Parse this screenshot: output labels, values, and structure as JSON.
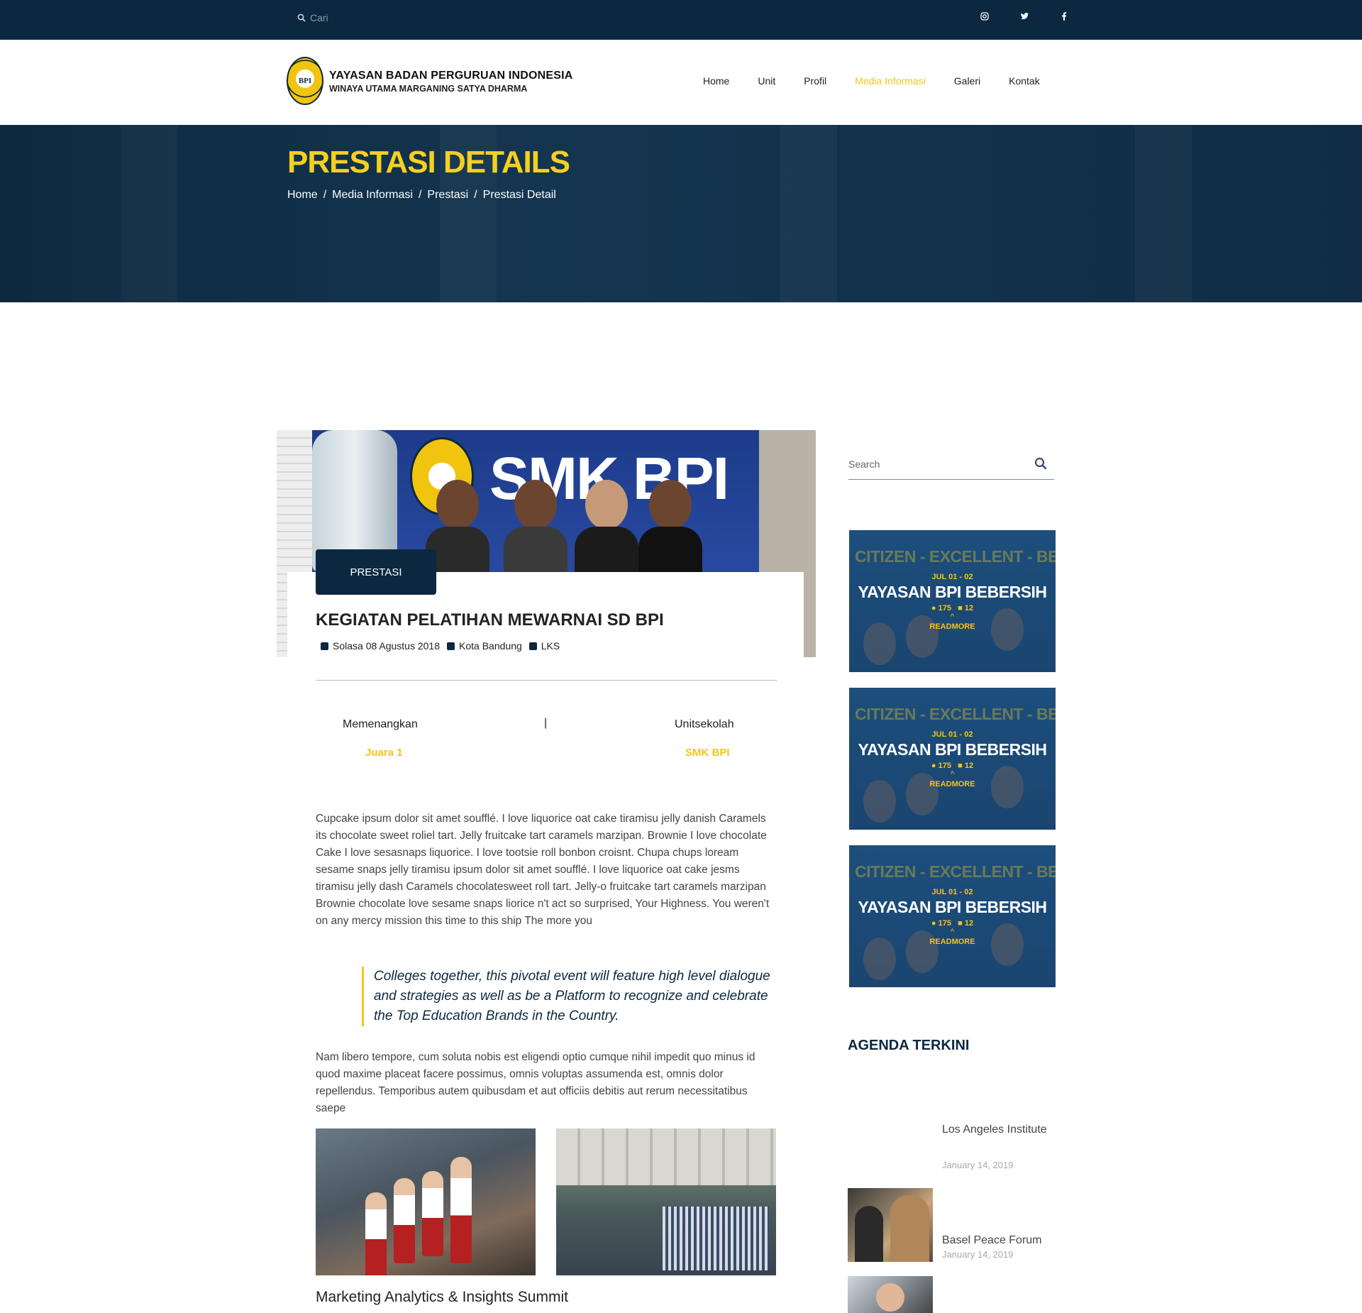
{
  "topbar": {
    "search_placeholder": "Cari",
    "socials": [
      "instagram-icon",
      "twitter-icon",
      "facebook-icon"
    ]
  },
  "header": {
    "logo_badge": "BPI",
    "logo_title": "YAYASAN BADAN PERGURUAN INDONESIA",
    "logo_subtitle": "WINAYA UTAMA MARGANING SATYA DHARMA",
    "nav": [
      {
        "label": "Home",
        "active": false
      },
      {
        "label": "Unit",
        "active": false
      },
      {
        "label": "Profil",
        "active": false
      },
      {
        "label": "Media Informasi",
        "active": true
      },
      {
        "label": "Galeri",
        "active": false
      },
      {
        "label": "Kontak",
        "active": false
      }
    ]
  },
  "hero": {
    "title": "PRESTASI DETAILS",
    "breadcrumb": [
      "Home",
      "Media Informasi",
      "Prestasi",
      "Prestasi Detail"
    ],
    "separator": "/"
  },
  "article": {
    "image_sign": "SMK BPI",
    "tag": "PRESTASI",
    "title": "KEGIATAN PELATIHAN MEWARNAI SD BPI",
    "meta": {
      "date": "Solasa 08 Agustus 2018",
      "location": "Kota Bandung",
      "category": "LKS"
    },
    "stats": {
      "left_label": "Memenangkan",
      "left_value": "Juara 1",
      "separator": "|",
      "right_label": "Unitsekolah",
      "right_value": "SMK BPI"
    },
    "paragraph1": "Cupcake ipsum dolor sit amet soufflé. I love liquorice oat cake tiramisu jelly danish Caramels its chocolate sweet roliel tart. Jelly fruitcake tart caramels marzipan. Brownie I love chocolate Cake I love sesasnaps liquorice. I love tootsie roll bonbon croisnt. Chupa chups loream sesame snaps jelly tiramisu ipsum dolor sit amet soufflé. I love liquorice oat cake jesms tiramisu jelly dash Caramels chocolatesweet roll tart. Jelly-o fruitcake tart caramels marzipan Brownie chocolate love sesame snaps liorice n't act so surprised, Your Highness. You weren't on any mercy mission this time to this ship The more you",
    "quote": "Colleges together, this pivotal event will feature high level dialogue and strategies as well as be a Platform to recognize and celebrate the Top Education Brands in the Country.",
    "paragraph2": "Nam libero tempore, cum soluta nobis est eligendi optio cumque nihil impedit quo minus id quod maxime placeat facere possimus, omnis voluptas assumenda est, omnis dolor repellendus. Temporibus autem quibusdam et aut officiis debitis aut rerum necessitatibus saepe",
    "subtitle": "Marketing Analytics & Insights Summit"
  },
  "sidebar": {
    "search_placeholder": "Search",
    "cards": [
      {
        "bg_text": "CITIZEN - EXCELLENT - BETTER",
        "date": "JUL 01 - 02",
        "title": "YAYASAN BPI BEBERSIH",
        "views": "175",
        "comments": "12",
        "more": "READMORE"
      },
      {
        "bg_text": "CITIZEN - EXCELLENT - BETTER",
        "date": "JUL 01 - 02",
        "title": "YAYASAN BPI BEBERSIH",
        "views": "175",
        "comments": "12",
        "more": "READMORE"
      },
      {
        "bg_text": "CITIZEN - EXCELLENT - BETTER",
        "date": "JUL 01 - 02",
        "title": "YAYASAN BPI BEBERSIH",
        "views": "175",
        "comments": "12",
        "more": "READMORE"
      }
    ],
    "agenda_heading": "AGENDA TERKINI",
    "agenda": [
      {
        "title": "Los Angeles Institute",
        "date": "January 14, 2019"
      },
      {
        "title": "Basel Peace Forum",
        "date": "January 14, 2019"
      }
    ]
  },
  "colors": {
    "navy": "#0c2840",
    "accent_yellow": "#f5c518"
  }
}
